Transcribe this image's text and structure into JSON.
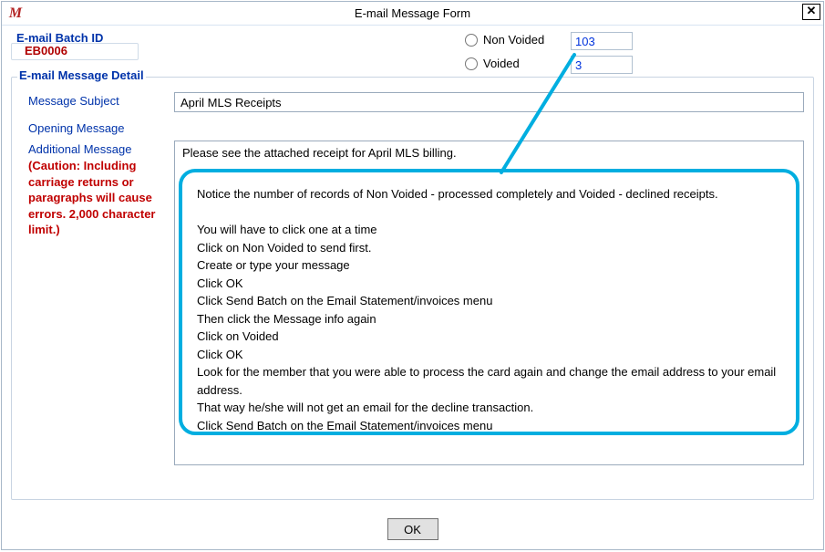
{
  "window": {
    "title": "E-mail Message Form",
    "icon_glyph": "M"
  },
  "batch": {
    "label": "E-mail Batch ID",
    "id": "EB0006"
  },
  "status": {
    "non_voided_label": "Non Voided",
    "voided_label": "Voided",
    "non_voided_count": "103",
    "voided_count": "3"
  },
  "detail": {
    "legend": "E-mail Message Detail",
    "subject_label": "Message Subject",
    "subject_value": "April MLS Receipts",
    "opening_label": "Opening Message",
    "additional_label": "Additional Message",
    "warning": "(Caution:  Including carriage returns or paragraphs will cause errors. 2,000 character limit.)",
    "additional_value": "Please see the attached receipt for April MLS billing."
  },
  "callout": {
    "l1": "Notice the number of records of Non Voided - processed completely and Voided - declined receipts.",
    "l2": "You will have to click one at a time",
    "l3": "Click on Non Voided to send first.",
    "l4": "Create or type your message",
    "l5": "Click OK",
    "l6": "Click Send Batch on the Email Statement/invoices menu",
    "l7": "Then click the Message info again",
    "l8": "Click on Voided",
    "l9": "Click OK",
    "l10": "Look for the member that you were able to process the card again and change the email address to your email address.",
    "l11": "That way he/she will not get an email for the decline transaction.",
    "l12": "Click Send Batch on the Email Statement/invoices menu"
  },
  "buttons": {
    "ok": "OK"
  }
}
